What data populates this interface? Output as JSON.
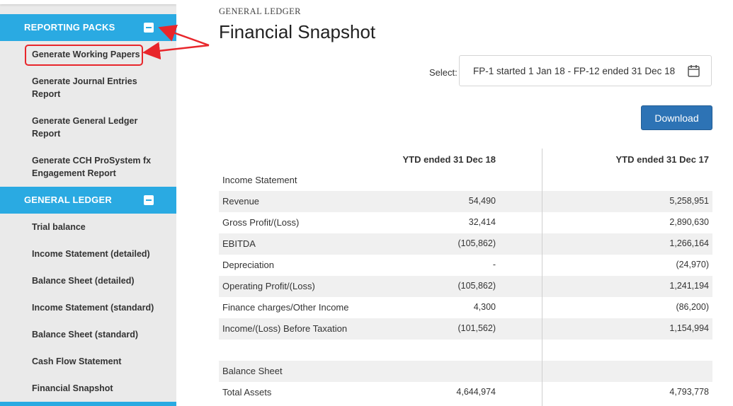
{
  "sidebar": {
    "sections": [
      {
        "title": "REPORTING PACKS",
        "items": [
          "Generate Working Papers",
          "Generate Journal Entries Report",
          "Generate General Ledger Report",
          "Generate CCH ProSystem fx Engagement Report"
        ]
      },
      {
        "title": "GENERAL LEDGER",
        "items": [
          "Trial balance",
          "Income Statement (detailed)",
          "Balance Sheet (detailed)",
          "Income Statement (standard)",
          "Balance Sheet (standard)",
          "Cash Flow Statement",
          "Financial Snapshot"
        ]
      }
    ],
    "highlighted_item": "Generate Working Papers"
  },
  "main": {
    "eyebrow": "GENERAL LEDGER",
    "title": "Financial Snapshot",
    "select_label": "Select:",
    "period_value": "FP-1 started 1 Jan 18 - FP-12 ended 31 Dec 18",
    "calendar_icon": "calendar-icon",
    "download_label": "Download"
  },
  "table": {
    "columns": [
      "YTD ended 31 Dec 18",
      "YTD ended 31 Dec 17"
    ],
    "rows": [
      {
        "label": "Income Statement",
        "v1": "",
        "v2": "",
        "shaded": false
      },
      {
        "label": "Revenue",
        "v1": "54,490",
        "v2": "5,258,951",
        "shaded": true
      },
      {
        "label": "Gross Profit/(Loss)",
        "v1": "32,414",
        "v2": "2,890,630",
        "shaded": false
      },
      {
        "label": "EBITDA",
        "v1": "(105,862)",
        "v2": "1,266,164",
        "shaded": true
      },
      {
        "label": "Depreciation",
        "v1": "-",
        "v2": "(24,970)",
        "shaded": false
      },
      {
        "label": "Operating Profit/(Loss)",
        "v1": "(105,862)",
        "v2": "1,241,194",
        "shaded": true
      },
      {
        "label": "Finance charges/Other Income",
        "v1": "4,300",
        "v2": "(86,200)",
        "shaded": false
      },
      {
        "label": "Income/(Loss) Before Taxation",
        "v1": "(101,562)",
        "v2": "1,154,994",
        "shaded": true
      },
      {
        "label": "",
        "v1": "",
        "v2": "",
        "shaded": false
      },
      {
        "label": "Balance Sheet",
        "v1": "",
        "v2": "",
        "shaded": true
      },
      {
        "label": "Total Assets",
        "v1": "4,644,974",
        "v2": "4,793,778",
        "shaded": false
      }
    ]
  },
  "colors": {
    "sidebar_header": "#2aaae2",
    "sidebar_bg": "#eaeaea",
    "download_button": "#2d73b5",
    "annotation": "#e8262b",
    "row_shade": "#f0f0f0"
  }
}
